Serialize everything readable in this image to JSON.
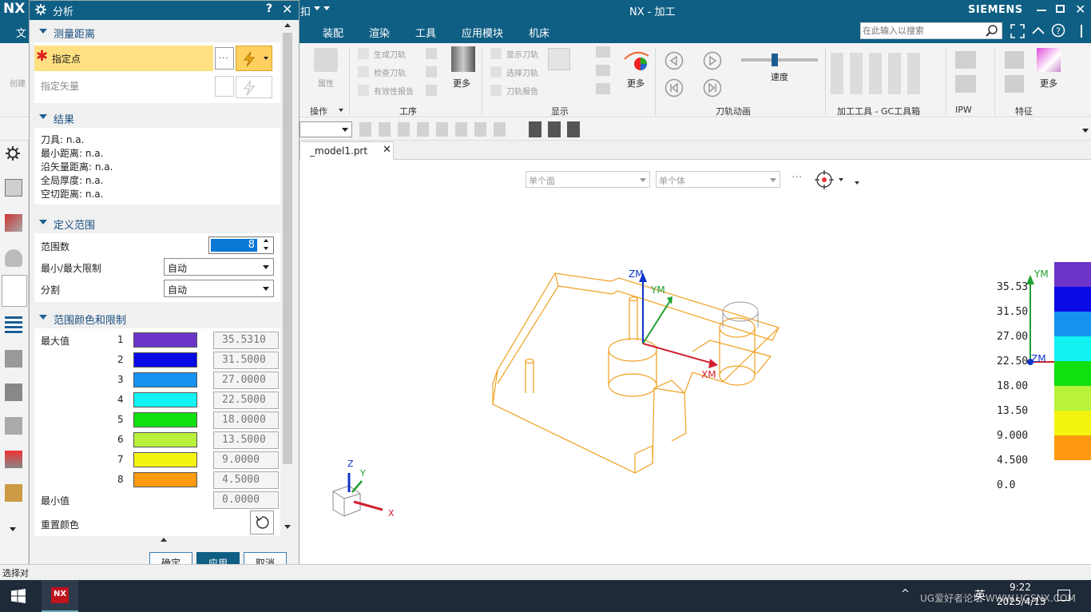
{
  "app": {
    "logo": "NX",
    "window_title": "NX - 加工",
    "brand": "SIEMENS",
    "partial_menu": "扣",
    "file_menu_fragment": "文",
    "search_placeholder": "在此输入以搜索"
  },
  "menu": [
    "装配",
    "渲染",
    "工具",
    "应用模块",
    "机床"
  ],
  "ribbon": {
    "left_fragment": "创建",
    "groups": [
      {
        "label": "操作",
        "items": [
          "属性"
        ]
      },
      {
        "label": "工序",
        "items": [
          "生成刀轨",
          "检查刀轨",
          "有效性报告",
          "更多"
        ]
      },
      {
        "label": "显示",
        "items": [
          "显示刀轨",
          "选择刀轨",
          "刀轨报告",
          "更多"
        ]
      },
      {
        "label": "刀轨动画",
        "items": [
          "速度"
        ]
      },
      {
        "label": "加工工具 - GC工具箱",
        "items": []
      },
      {
        "label": "IPW",
        "items": []
      },
      {
        "label": "特征",
        "items": [
          "更多"
        ]
      }
    ]
  },
  "tabs": {
    "active": "_model1.prt"
  },
  "view_filters": {
    "face_filter": "单个面",
    "body_filter": "单个体"
  },
  "dialog": {
    "title": "分析",
    "help": "?",
    "close": "✕",
    "sections": {
      "measure": {
        "title": "测量距离",
        "specify_point": "指定点",
        "specify_vector": "指定矢量"
      },
      "results": {
        "title": "结果",
        "lines": [
          "刀具: n.a.",
          "最小距离: n.a.",
          "沿矢量距离: n.a.",
          "全局厚度: n.a.",
          "空切距离: n.a."
        ]
      },
      "range": {
        "title": "定义范围",
        "count_label": "范围数",
        "count_value": "8",
        "limit_label": "最小/最大限制",
        "limit_value": "自动",
        "split_label": "分割",
        "split_value": "自动"
      },
      "colors": {
        "title": "范围颜色和限制",
        "max_label": "最大值",
        "min_label": "最小值",
        "reset_label": "重置颜色",
        "rows": [
          {
            "index": "1",
            "color": "#6a35c8",
            "value": "35.5310"
          },
          {
            "index": "2",
            "color": "#0a0ae6",
            "value": "31.5000"
          },
          {
            "index": "3",
            "color": "#1592f0",
            "value": "27.0000"
          },
          {
            "index": "4",
            "color": "#12f2f2",
            "value": "22.5000"
          },
          {
            "index": "5",
            "color": "#10e010",
            "value": "18.0000"
          },
          {
            "index": "6",
            "color": "#b8f23a",
            "value": "13.5000"
          },
          {
            "index": "7",
            "color": "#f4f410",
            "value": "9.0000"
          },
          {
            "index": "8",
            "color": "#ff9a10",
            "value": "4.5000"
          }
        ],
        "min_value": "0.0000"
      }
    },
    "buttons": {
      "ok": "确定",
      "apply": "应用",
      "cancel": "取消"
    }
  },
  "legend": {
    "labels": [
      "35.53",
      "31.50",
      "27.00",
      "22.50",
      "18.00",
      "13.50",
      "9.000",
      "4.500",
      "0.0"
    ],
    "colors": [
      "#6a35c8",
      "#0a0ae6",
      "#1592f0",
      "#12f2f2",
      "#10e010",
      "#b8f23a",
      "#f4f410",
      "#ff9a10"
    ]
  },
  "viewport_axes": {
    "zm": "ZM",
    "ym": "YM",
    "xm": "XM",
    "z": "Z",
    "y": "Y",
    "x": "X"
  },
  "status": {
    "text": "选择对"
  },
  "taskbar": {
    "time": "9:22",
    "date": "2025/4/13",
    "ime": "英",
    "watermark": "UG爱好者论坛 WWW.UGSNX.COM"
  }
}
